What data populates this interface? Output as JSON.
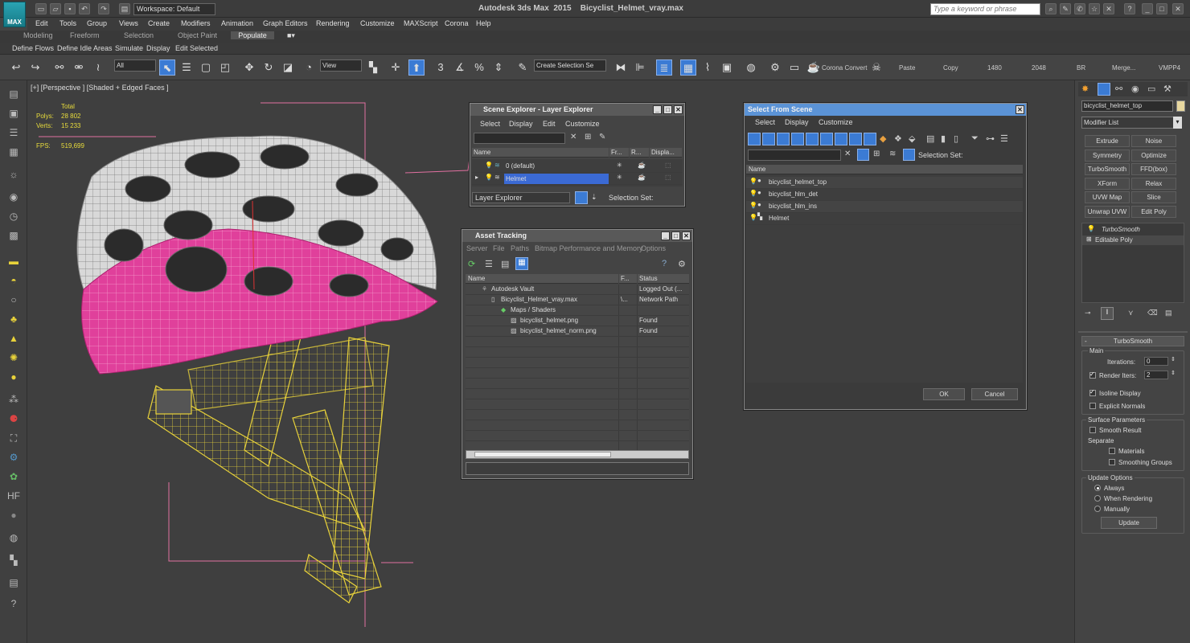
{
  "app": {
    "logo": "MAX",
    "title": "Autodesk 3ds Max  2015    Bicyclist_Helmet_vray.max",
    "workspace": "Workspace: Default",
    "search_placeholder": "Type a keyword or phrase"
  },
  "menus": [
    "Edit",
    "Tools",
    "Group",
    "Views",
    "Create",
    "Modifiers",
    "Animation",
    "Graph Editors",
    "Rendering",
    "Customize",
    "MAXScript",
    "Corona",
    "Help"
  ],
  "ribbon_tabs": [
    "Modeling",
    "Freeform",
    "Selection",
    "Object Paint",
    "Populate"
  ],
  "ribbon_sub": [
    "Define Flows",
    "Define Idle Areas",
    "Simulate",
    "Display",
    "Edit Selected"
  ],
  "toolbar": {
    "filter": "All",
    "view": "View",
    "create_selection_set": "Create Selection Se",
    "corona_convert": "Corona Convert",
    "paste": "Paste",
    "copy": "Copy",
    "w1480": "1480",
    "w2048": "2048",
    "br": "BR",
    "merge": "Merge...",
    "vmpp4": "VMPP4",
    "snap_3": "3",
    "snap_pct": "%"
  },
  "viewport": {
    "label": "[+] [Perspective ] [Shaded + Edged Faces ]",
    "stats": {
      "total": "Total",
      "polys_label": "Polys:",
      "polys": "28 802",
      "verts_label": "Verts:",
      "verts": "15 233",
      "fps_label": "FPS:",
      "fps": "519,699"
    }
  },
  "scene_explorer": {
    "title": "Scene Explorer - Layer Explorer",
    "menus": [
      "Select",
      "Display",
      "Edit",
      "Customize"
    ],
    "columns": [
      "Name",
      "Fr...",
      "R...",
      "Displa..."
    ],
    "rows": [
      {
        "name": "0 (default)"
      },
      {
        "name": "Helmet"
      }
    ],
    "footer": "Layer Explorer",
    "selection_set": "Selection Set:"
  },
  "asset_tracking": {
    "title": "Asset Tracking",
    "menus": [
      "Server",
      "File",
      "Paths",
      "Bitmap Performance and Memory",
      "Options"
    ],
    "columns": [
      "Name",
      "F...",
      "Status"
    ],
    "rows": [
      {
        "name": "Autodesk Vault",
        "f": "",
        "status": "Logged Out (..."
      },
      {
        "name": "Bicyclist_Helmet_vray.max",
        "f": "\\...",
        "status": "Network Path"
      },
      {
        "name": "Maps / Shaders",
        "f": "",
        "status": ""
      },
      {
        "name": "bicyclist_helmet.png",
        "f": "",
        "status": "Found"
      },
      {
        "name": "bicyclist_helmet_norm.png",
        "f": "",
        "status": "Found"
      }
    ]
  },
  "select_from_scene": {
    "title": "Select From Scene",
    "menus": [
      "Select",
      "Display",
      "Customize"
    ],
    "column": "Name",
    "selection_set": "Selection Set:",
    "rows": [
      "bicyclist_helmet_top",
      "bicyclist_hlm_det",
      "bicyclist_hlm_ins",
      "Helmet"
    ],
    "ok": "OK",
    "cancel": "Cancel"
  },
  "command_panel": {
    "object_name": "bicyclist_helmet_top",
    "modifier_list": "Modifier List",
    "mod_buttons": [
      "Extrude",
      "Noise",
      "Symmetry",
      "Optimize",
      "TurboSmooth",
      "FFD(box)",
      "XForm",
      "Relax",
      "UVW Map",
      "Slice",
      "Unwrap UVW",
      "Edit Poly"
    ],
    "stack": [
      "TurboSmooth",
      "Editable Poly"
    ],
    "rollout": "TurboSmooth",
    "main": "Main",
    "iterations_label": "Iterations:",
    "iterations": "0",
    "render_iters_label": "Render Iters:",
    "render_iters": "2",
    "isoline": "Isoline Display",
    "explicit": "Explicit Normals",
    "surface": "Surface Parameters",
    "smooth_result": "Smooth Result",
    "separate": "Separate",
    "materials": "Materials",
    "smoothing_groups": "Smoothing Groups",
    "update_options": "Update Options",
    "always": "Always",
    "when_rendering": "When Rendering",
    "manually": "Manually",
    "update": "Update"
  },
  "colors": {
    "accent": "#5b93d6",
    "helmet_pink": "#e0409b",
    "wire_yellow": "#e8d23a",
    "bg": "#444444"
  }
}
